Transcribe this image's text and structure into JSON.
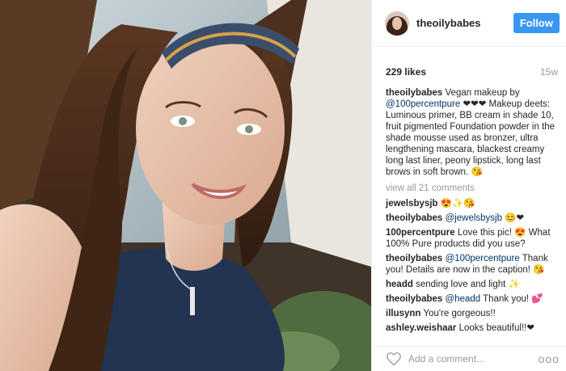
{
  "post": {
    "username": "theoilybabes",
    "follow_label": "Follow",
    "likes": "229 likes",
    "time_ago": "15w",
    "caption": {
      "username": "theoilybabes",
      "text_pre": "Vegan makeup by",
      "mention": "@100percentpure",
      "text_post": "❤❤❤ Makeup deets: Luminous primer, BB cream in shade 10, fruit pigmented Foundation powder in the shade mousse used as bronzer, ultra lengthening mascara, blackest creamy long last liner, peony lipstick, long last brows in soft brown. 😘"
    },
    "view_all": "view all 21 comments",
    "comments": [
      {
        "user": "jewelsbysjb",
        "pre": "",
        "mention": "",
        "post": "😍✨😘"
      },
      {
        "user": "theoilybabes",
        "pre": "",
        "mention": "@jewelsbysjb",
        "post": " 😊❤"
      },
      {
        "user": "100percentpure",
        "pre": "Love this pic! 😍 What 100% Pure products did you use?",
        "mention": "",
        "post": ""
      },
      {
        "user": "theoilybabes",
        "pre": "",
        "mention": "@100percentpure",
        "post": " Thank you! Details are now in the caption! 😘"
      },
      {
        "user": "headd",
        "pre": "sending love and light ✨",
        "mention": "",
        "post": ""
      },
      {
        "user": "theoilybabes",
        "pre": "",
        "mention": "@headd",
        "post": " Thank you! 💕"
      },
      {
        "user": "illusynn",
        "pre": "You're gorgeous!!",
        "mention": "",
        "post": ""
      },
      {
        "user": "ashley.weishaar",
        "pre": "Looks beautiful!!❤",
        "mention": "",
        "post": ""
      }
    ],
    "add_comment_placeholder": "Add a comment...",
    "more_label": "ooo"
  },
  "colors": {
    "follow_bg": "#3897f0",
    "mention": "#003569",
    "muted": "#999999"
  }
}
